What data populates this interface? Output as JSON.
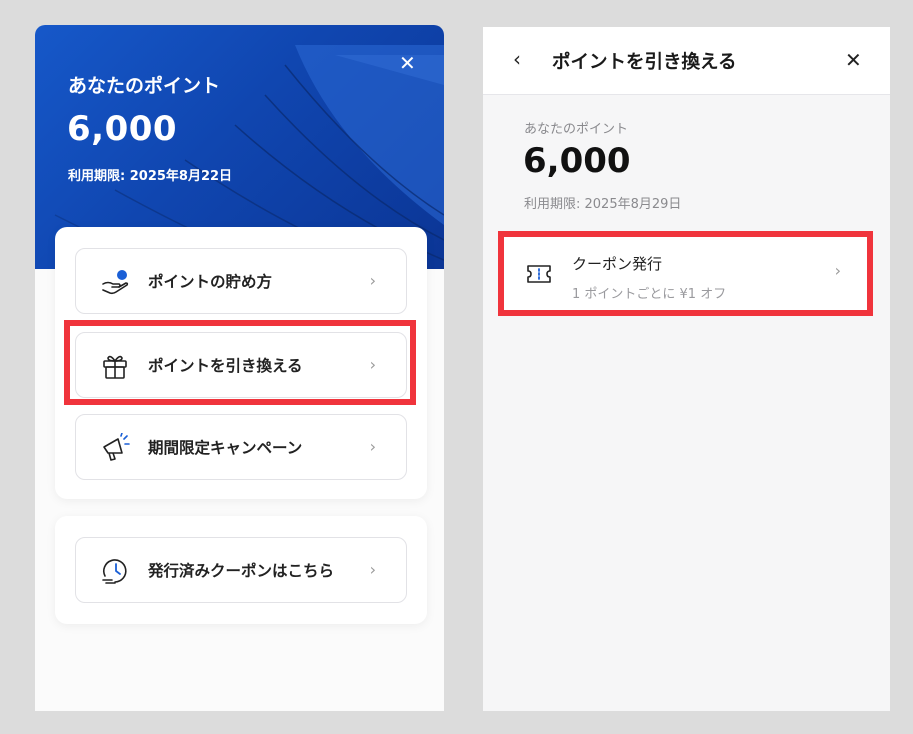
{
  "left_panel": {
    "hero": {
      "title": "あなたのポイント",
      "points": "6,000",
      "expiry": "利用期限: 2025年8月22日",
      "close_symbol": "✕"
    },
    "menu": [
      {
        "label": "ポイントの貯め方",
        "icon": "hand-coin-icon"
      },
      {
        "label": "ポイントを引き換える",
        "icon": "gift-icon"
      },
      {
        "label": "期間限定キャンペーン",
        "icon": "megaphone-icon"
      }
    ],
    "coupon_link": {
      "label": "発行済みクーポンはこちら",
      "icon": "clock-history-icon"
    },
    "chevron": "›"
  },
  "right_panel": {
    "header": {
      "back_symbol": "‹",
      "title": "ポイントを引き換える",
      "close_symbol": "✕"
    },
    "points_label": "あなたのポイント",
    "points": "6,000",
    "expiry": "利用期限: 2025年8月29日",
    "coupon_option": {
      "title": "クーポン発行",
      "description": "1 ポイントごとに ¥1 オフ",
      "icon": "ticket-icon"
    },
    "chevron": "›"
  },
  "colors": {
    "hero_blue": "#1046b0",
    "highlight_red": "#f0343c",
    "accent_blue": "#1a5fd6"
  }
}
